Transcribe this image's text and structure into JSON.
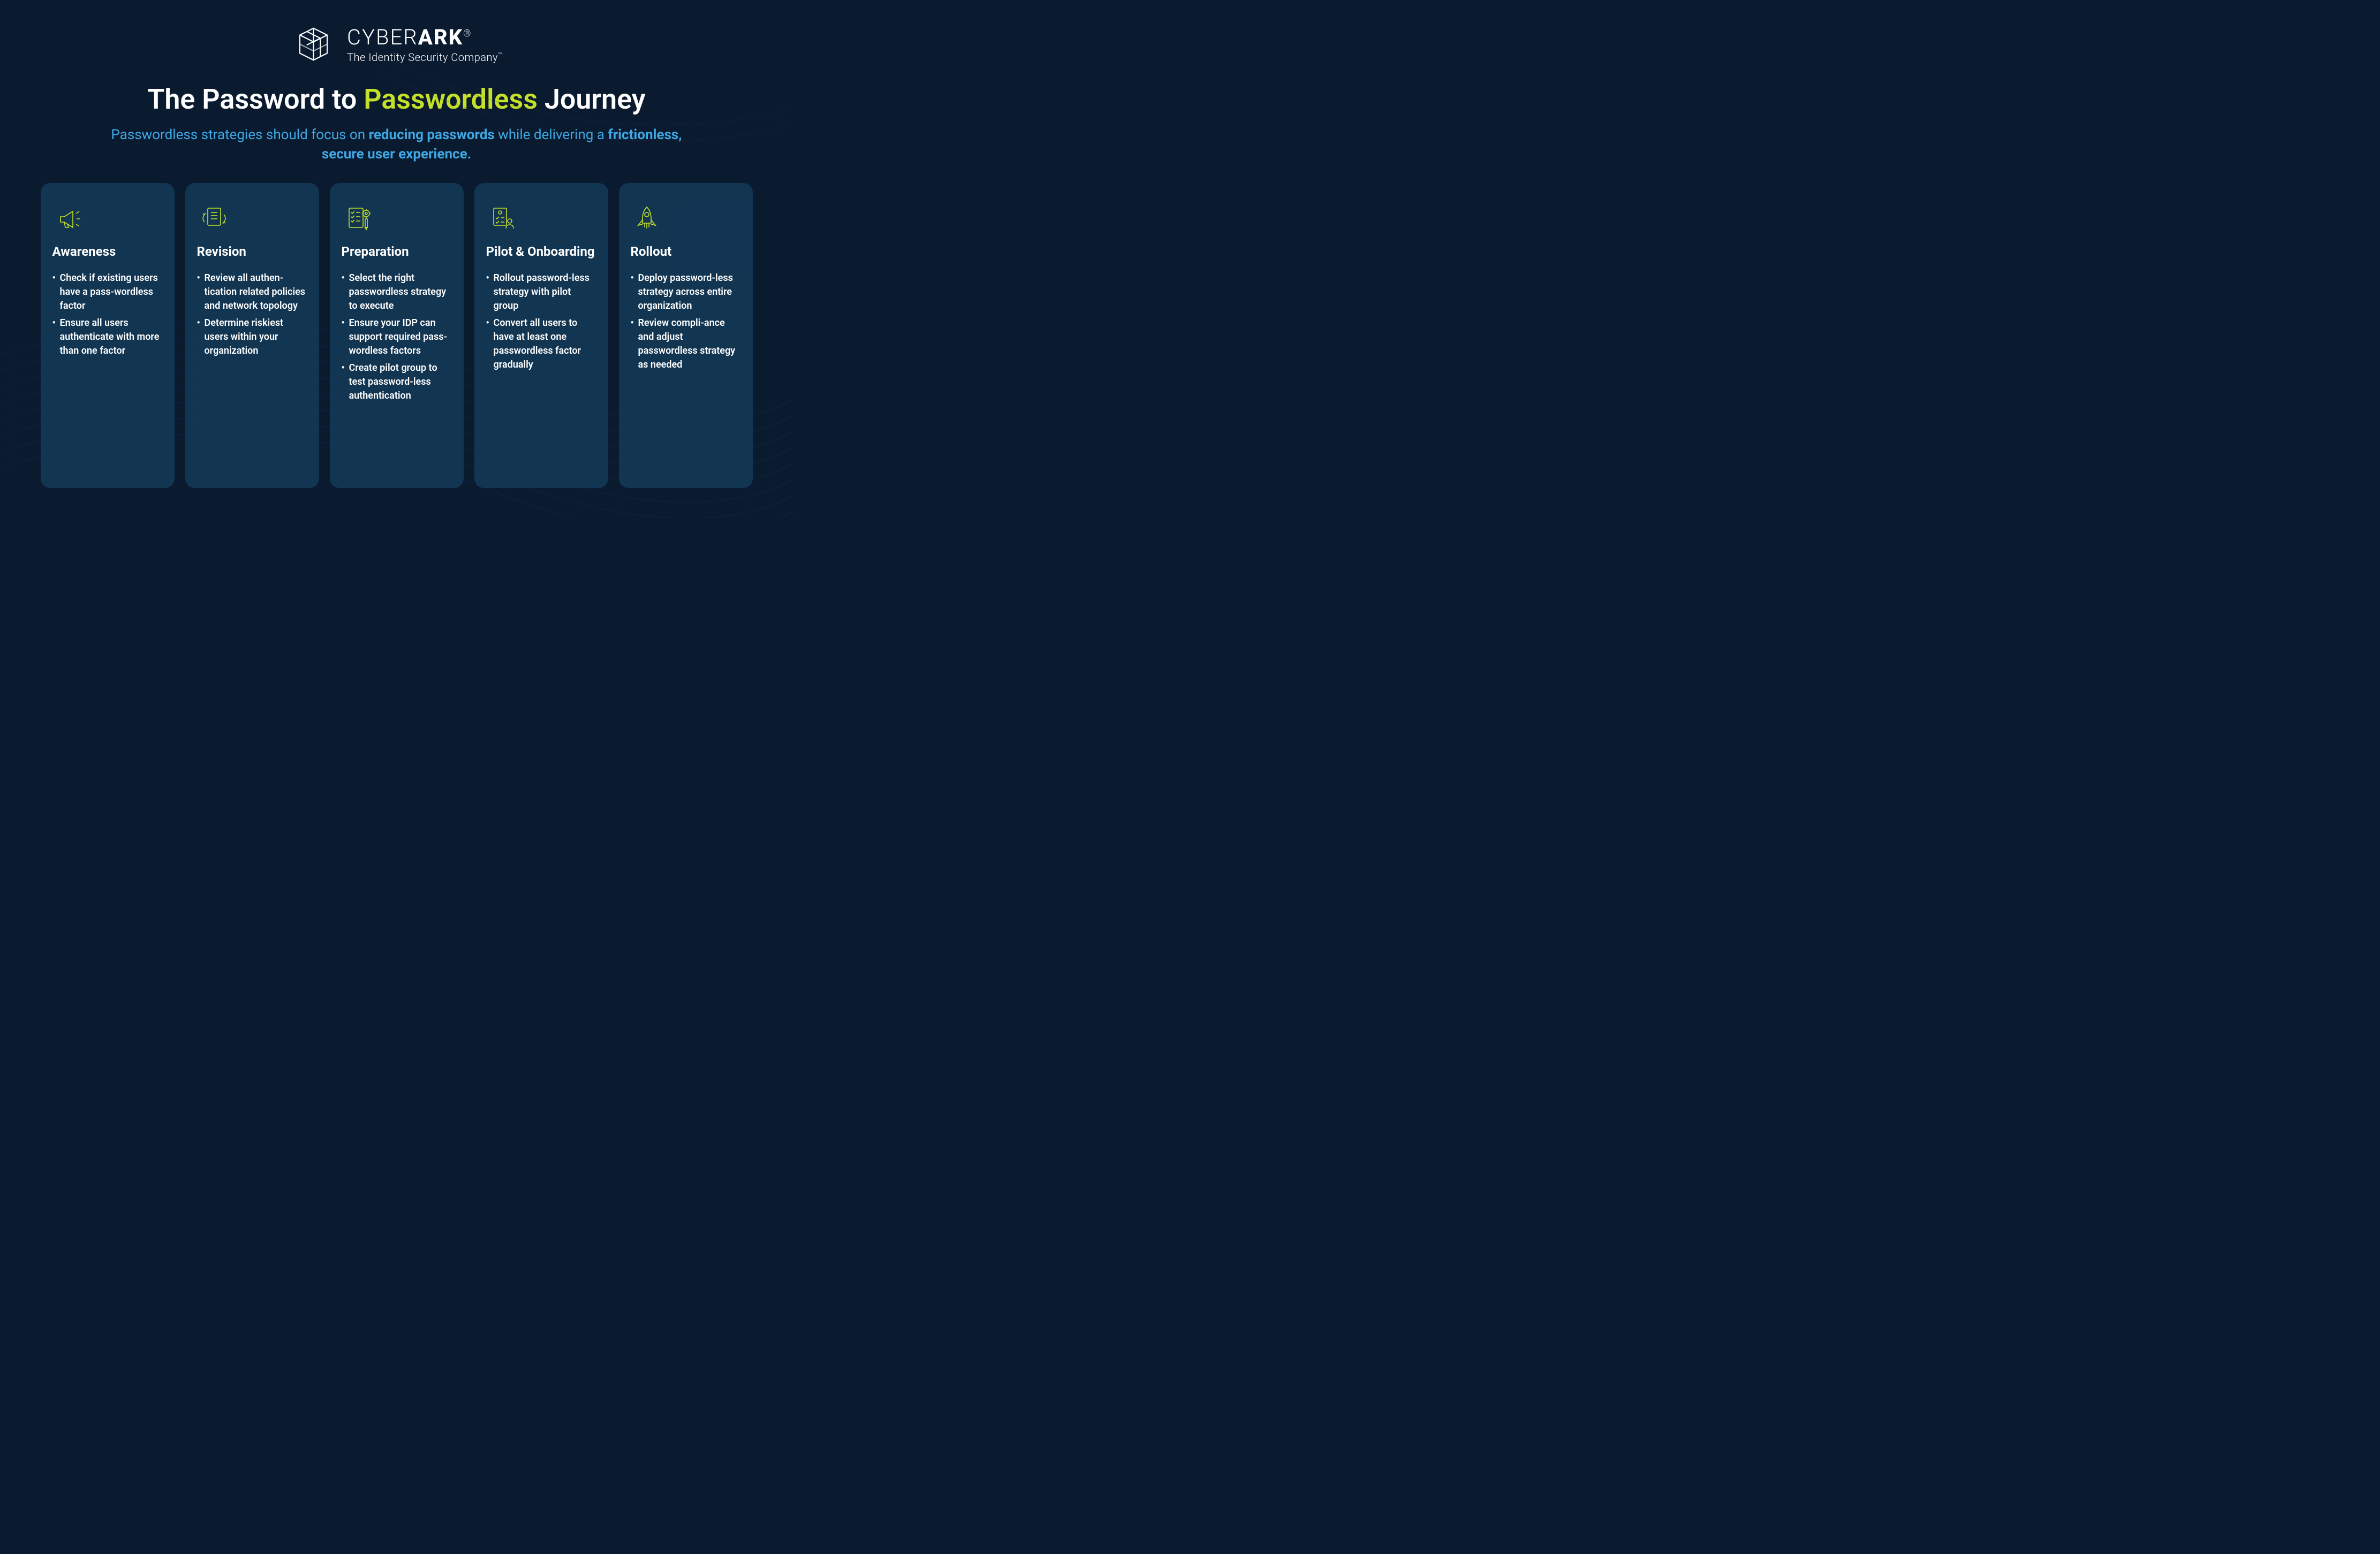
{
  "brand": {
    "name_left": "CYBER",
    "name_right": "ARK",
    "registered": "®",
    "tagline": "The Identity Security Company",
    "trademark": "™"
  },
  "title": {
    "part1": "The Password to ",
    "accent": "Passwordless",
    "part2": " Journey"
  },
  "subtitle": {
    "t1": "Passwordless strategies should focus on ",
    "b1": "reducing passwords",
    "t2": " while delivering a ",
    "b2": "frictionless, secure user experience."
  },
  "cards": [
    {
      "icon": "megaphone-icon",
      "title": "Awareness",
      "bullets": [
        "Check if existing users have a pass-wordless factor",
        "Ensure all users authenticate with more than one factor"
      ]
    },
    {
      "icon": "revision-icon",
      "title": "Revision",
      "bullets": [
        "Review all authen-tication related policies and network topology",
        "Determine riskiest users within your organization"
      ]
    },
    {
      "icon": "checklist-icon",
      "title": "Preparation",
      "bullets": [
        "Select the right passwordless strategy to execute",
        "Ensure your IDP can support required pass-wordless factors",
        "Create pilot group to test password-less authentication"
      ]
    },
    {
      "icon": "pilot-icon",
      "title": "Pilot & Onboarding",
      "bullets": [
        "Rollout password-less strategy with pilot group",
        "Convert all users to have at least one passwordless factor gradually"
      ]
    },
    {
      "icon": "rocket-icon",
      "title": "Rollout",
      "bullets": [
        "Deploy password-less strategy across entire organization",
        "Review compli-ance and adjust passwordless strategy as needed"
      ]
    }
  ]
}
